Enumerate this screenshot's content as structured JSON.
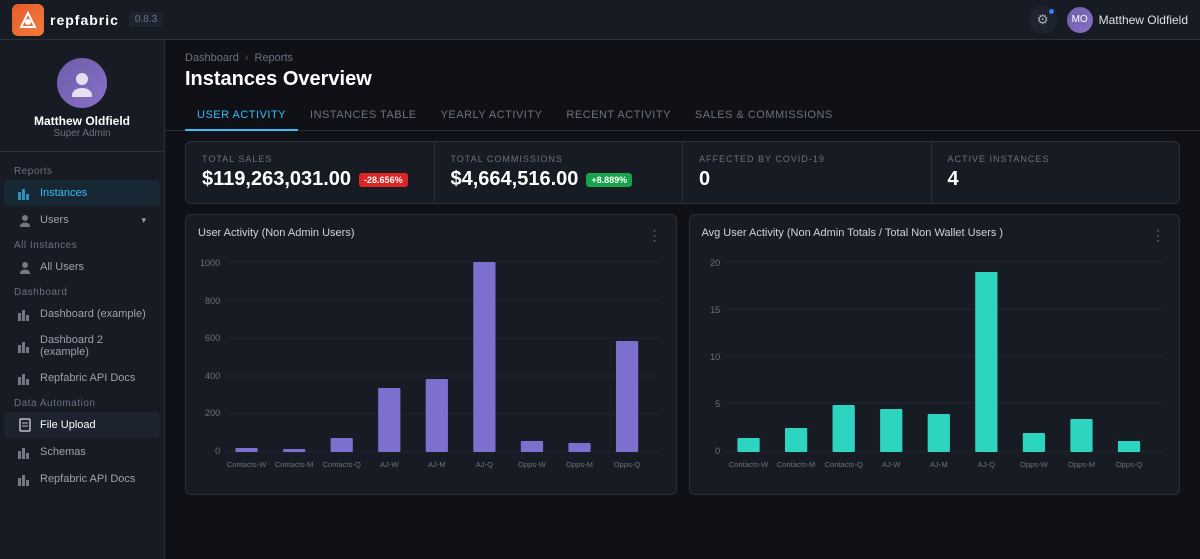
{
  "topNav": {
    "logoText": "repfabric",
    "version": "0.8.3",
    "userName": "Matthew Oldfield",
    "gearIcon": "⚙"
  },
  "sidebar": {
    "profile": {
      "name": "Matthew Oldfield",
      "role": "Super Admin"
    },
    "sections": [
      {
        "label": "Reports",
        "items": [
          {
            "id": "instances",
            "label": "Instances",
            "icon": "bar",
            "active": true
          },
          {
            "id": "users",
            "label": "Users",
            "icon": "user",
            "expandable": true
          }
        ]
      },
      {
        "label": "All Instances",
        "items": [
          {
            "id": "all-users",
            "label": "All Users",
            "icon": "user"
          }
        ]
      },
      {
        "label": "Dashboard",
        "items": [
          {
            "id": "dashboard-example",
            "label": "Dashboard (example)",
            "icon": "dashboard"
          },
          {
            "id": "dashboard2-example",
            "label": "Dashboard 2 (example)",
            "icon": "dashboard"
          },
          {
            "id": "repfabric-api-docs",
            "label": "Repfabric API Docs",
            "icon": "bar"
          }
        ]
      },
      {
        "label": "Data Automation",
        "items": [
          {
            "id": "file-upload",
            "label": "File Upload",
            "icon": "file",
            "highlighted": true
          },
          {
            "id": "schemas",
            "label": "Schemas",
            "icon": "bar"
          },
          {
            "id": "repfabric-api-docs2",
            "label": "Repfabric API Docs",
            "icon": "bar"
          }
        ]
      }
    ]
  },
  "page": {
    "breadcrumb": [
      "Dashboard",
      "Reports"
    ],
    "title": "Instances Overview"
  },
  "tabs": [
    {
      "id": "user-activity",
      "label": "User Activity",
      "active": true
    },
    {
      "id": "instances-table",
      "label": "Instances Table"
    },
    {
      "id": "yearly-activity",
      "label": "Yearly Activity"
    },
    {
      "id": "recent-activity",
      "label": "Recent Activity"
    },
    {
      "id": "sales-commissions",
      "label": "Sales & Commissions"
    }
  ],
  "stats": [
    {
      "id": "total-sales",
      "label": "Total Sales",
      "value": "$119,263,031.00",
      "badge": "-28.656%",
      "badgeType": "red"
    },
    {
      "id": "total-commissions",
      "label": "Total Commissions",
      "value": "$4,664,516.00",
      "badge": "+8.889%",
      "badgeType": "green"
    },
    {
      "id": "affected-covid",
      "label": "Affected by Covid-19",
      "value": "0"
    },
    {
      "id": "active-instances",
      "label": "Active Instances",
      "value": "4"
    }
  ],
  "charts": [
    {
      "id": "user-activity-chart",
      "title": "User Activity (Non Admin Users)",
      "yLabels": [
        "1000",
        "800",
        "600",
        "400",
        "200",
        "0"
      ],
      "xLabels": [
        "Contacts-W",
        "Contacts-M",
        "Contacts-Q",
        "AJ-W",
        "AJ-M",
        "AJ-Q",
        "Opps-W",
        "Opps-M",
        "Opps-Q"
      ],
      "bars": [
        20,
        15,
        80,
        360,
        410,
        1060,
        60,
        50,
        620
      ],
      "barColor": "#7c6fcd"
    },
    {
      "id": "avg-user-activity-chart",
      "title": "Avg User Activity (Non Admin Totals / Total Non Wallet Users )",
      "yLabels": [
        "20",
        "15",
        "10",
        "5",
        "0"
      ],
      "xLabels": [
        "Contacts-W",
        "Contacts-M",
        "Contacts-Q",
        "AJ-W",
        "AJ-M",
        "AJ-Q",
        "Opps-W",
        "Opps-M",
        "Opps-Q"
      ],
      "bars": [
        1.5,
        2.5,
        5,
        4.5,
        4,
        19,
        2,
        3.5,
        1.2
      ],
      "barColor": "#2dd4bf"
    }
  ]
}
